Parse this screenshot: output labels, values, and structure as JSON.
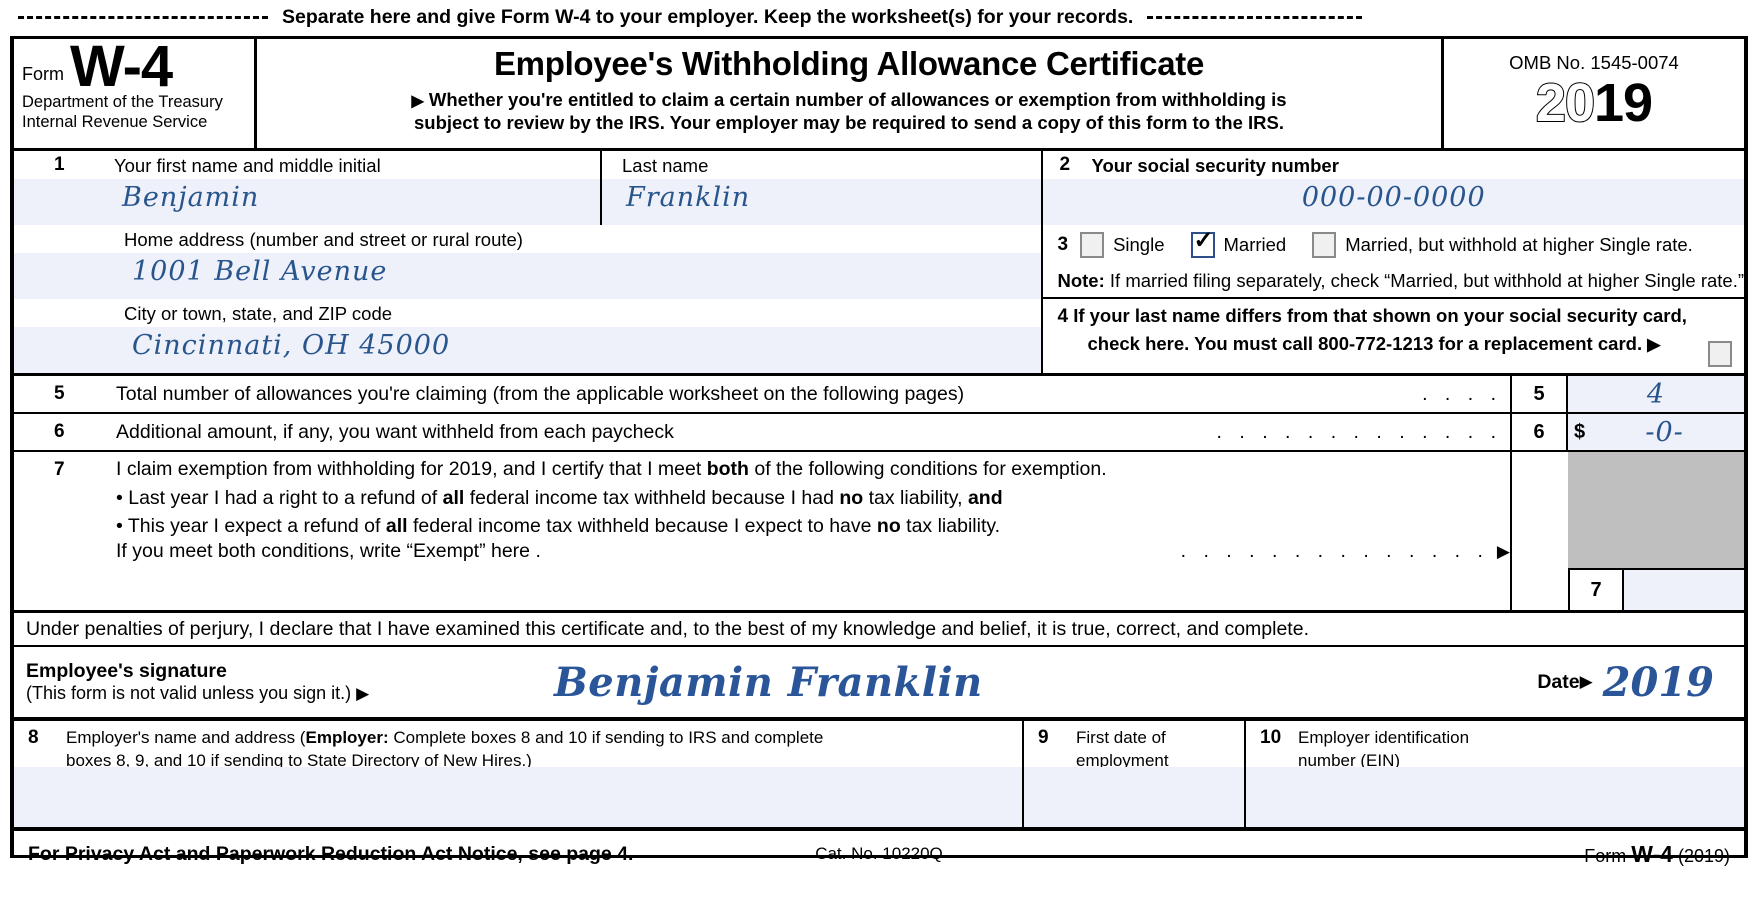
{
  "separator": {
    "text": "Separate here and give Form W-4 to your employer. Keep the worksheet(s) for your records."
  },
  "header": {
    "form_label": "Form",
    "form_number": "W-4",
    "department_line1": "Department of the Treasury",
    "department_line2": "Internal Revenue Service",
    "title": "Employee's Withholding Allowance Certificate",
    "subtitle_arrow": "▶",
    "subtitle_line1": "Whether you're entitled to claim a certain number of allowances or exemption from withholding is",
    "subtitle_line2": "subject to review by the IRS. Your employer may be required to send a copy of this form to the IRS.",
    "omb": "OMB No. 1545-0074",
    "year_outline": "20",
    "year_solid": "19"
  },
  "line1": {
    "number": "1",
    "first_name_label": "Your first name and middle initial",
    "first_name_value": "Benjamin",
    "last_name_label": "Last name",
    "last_name_value": "Franklin"
  },
  "line2": {
    "number": "2",
    "label": "Your social security number",
    "value": "000-00-0000"
  },
  "address": {
    "home_label": "Home address (number and street or rural route)",
    "home_value": "1001 Bell Avenue",
    "city_label": "City or town, state, and ZIP code",
    "city_value": "Cincinnati, OH 45000"
  },
  "line3": {
    "number": "3",
    "options": [
      {
        "label": "Single",
        "checked": false
      },
      {
        "label": "Married",
        "checked": true
      },
      {
        "label": "Married, but withhold at higher Single rate.",
        "checked": false
      }
    ],
    "note_bold": "Note:",
    "note_text": "If married filing separately, check “Married, but withhold at higher Single rate.”"
  },
  "line4": {
    "number": "4",
    "text_line1": "If your last name differs from that shown on your social security card,",
    "text_line2": "check here. You must call 800-772-1213 for a replacement card.",
    "arrow": "▶",
    "checked": false
  },
  "line5": {
    "number": "5",
    "text": "Total number of allowances you're claiming (from the applicable worksheet on the following pages)",
    "dots": ".    .    .    .",
    "box_key": "5",
    "value": "4"
  },
  "line6": {
    "number": "6",
    "text": "Additional amount, if any, you want withheld from each paycheck",
    "dots": ".   .   .   .   .   .   .   .   .   .   .   .   .",
    "box_key": "6",
    "currency": "$",
    "value": "-0-"
  },
  "line7": {
    "number": "7",
    "intro_pre": "I claim exemption from withholding for 2019, and I certify that I meet ",
    "intro_bold": "both",
    "intro_post": " of the following conditions for exemption.",
    "bullet1_a": "• Last year I had a right to a refund of ",
    "bullet1_b": "all",
    "bullet1_c": " federal income tax withheld because I had ",
    "bullet1_d": "no",
    "bullet1_e": " tax liability, ",
    "bullet1_f": "and",
    "bullet2_a": "• This year I expect a refund of ",
    "bullet2_b": "all",
    "bullet2_c": " federal income tax withheld because I expect to have ",
    "bullet2_d": "no",
    "bullet2_e": " tax liability.",
    "exempt_text": "If you meet both conditions, write “Exempt” here .",
    "exempt_dots": ".   .   .   .   .   .   .   .   .   .   .   .   .   .",
    "exempt_arrow": "▶",
    "box_key": "7",
    "value": ""
  },
  "perjury": {
    "text": "Under penalties of perjury, I declare that I have examined this certificate and, to the best of my knowledge and belief, it is true, correct, and complete."
  },
  "signature": {
    "label_line1": "Employee's signature",
    "label_line2": "(This form is not valid unless you sign it.)",
    "arrow": "▶",
    "value": "Benjamin Franklin",
    "date_label": "Date",
    "date_arrow": "▶",
    "date_value": "2019"
  },
  "employer": {
    "box8": {
      "number": "8",
      "text_pre": "Employer's name and address (",
      "text_bold": "Employer:",
      "text_post": " Complete boxes 8 and 10 if sending to IRS and complete",
      "text_line2": "boxes 8, 9, and 10 if sending to State Directory of New Hires.)",
      "value": ""
    },
    "box9": {
      "number": "9",
      "label_line1": "First date of",
      "label_line2": "employment",
      "value": ""
    },
    "box10": {
      "number": "10",
      "label_line1": "Employer identification",
      "label_line2": "number (EIN)",
      "value": ""
    }
  },
  "footer": {
    "privacy": "For Privacy Act and Paperwork Reduction Act Notice, see page 4.",
    "catalog": "Cat. No. 10220Q",
    "form_pre": "Form ",
    "form_bold": "W-4",
    "form_year": " (2019)"
  },
  "colors": {
    "field_fill": "#eef0fa",
    "handwriting": "#27558c",
    "signature": "#2a5699",
    "shaded": "#bfbfbf"
  }
}
